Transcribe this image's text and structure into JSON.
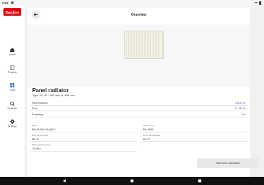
{
  "status_bar": {
    "time": "9:29"
  },
  "brand": {
    "logo_text": "Danfoss",
    "color": "#e2000f"
  },
  "nav": {
    "items": [
      {
        "label": "Home",
        "icon": "home-icon"
      },
      {
        "label": "Projects",
        "icon": "document-icon"
      },
      {
        "label": "Tools",
        "icon": "grid-icon",
        "active": true
      },
      {
        "label": "Products",
        "icon": "search-icon"
      },
      {
        "label": "Settings",
        "icon": "gear-icon"
      }
    ]
  },
  "header": {
    "title": "Overview"
  },
  "product": {
    "name": "Panel radiator",
    "type": "Type: 20, W: 1200 mm, H: 600 mm"
  },
  "results": [
    {
      "label": "Heat emission",
      "value": "748.37 W"
    },
    {
      "label": "Flow",
      "value": "21.453 l/h"
    },
    {
      "label": "Presetting",
      "value": "3 N"
    }
  ],
  "params": [
    {
      "label": "Valve",
      "value": "RA-N, DN 10 (3/8\")"
    },
    {
      "label": "Valve sensor",
      "value": "RA 2000"
    },
    {
      "label": "Flow temperature",
      "value": "60 °C"
    },
    {
      "label": "Room temperature",
      "value": "20 °C"
    },
    {
      "label": "Differential pressure",
      "value": "10 kPa"
    }
  ],
  "actions": {
    "new_calculation": "Start new calculation"
  },
  "colors": {
    "accent": "#1f5fa8",
    "background": "#f1f1f1"
  }
}
